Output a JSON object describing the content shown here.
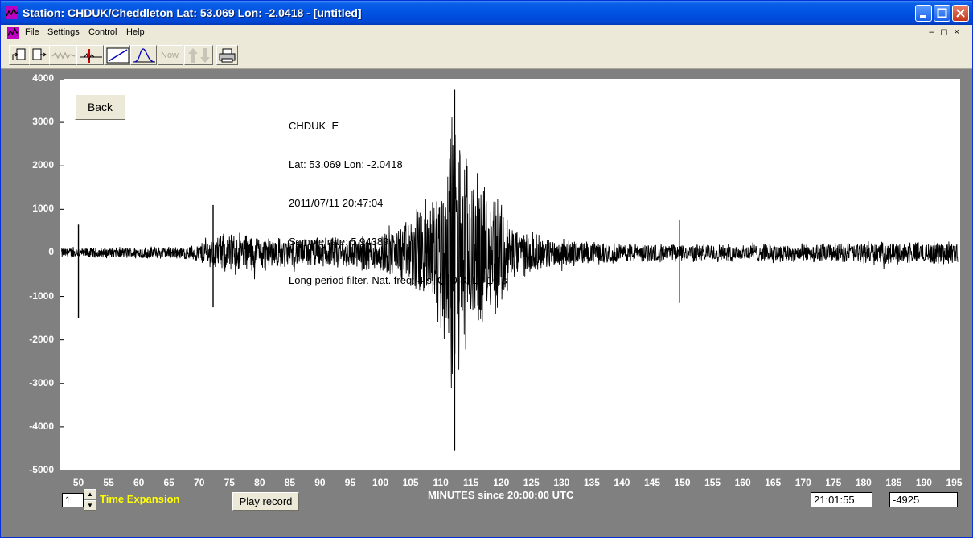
{
  "window": {
    "title": "Station: CHDUK/Cheddleton Lat: 53.069 Lon: -2.0418 - [untitled]"
  },
  "menu": {
    "items": [
      "File",
      "Settings",
      "Control",
      "Help"
    ],
    "mdi_controls": "–◻×"
  },
  "toolbar": {
    "now_label": "Now",
    "tools": [
      "open-file-icon",
      "save-file-icon",
      "wave-icon",
      "marker-icon",
      "ramp-icon",
      "curve-icon",
      "now-icon",
      "up-down-arrows-icon",
      "print-icon"
    ]
  },
  "plot": {
    "back_label": "Back",
    "info_lines": [
      "CHDUK  E",
      "Lat: 53.069 Lon: -2.0418",
      "2011/07/11 20:47:04",
      "Sample rate: 5.94389",
      "Long period filter. Nat. freq: 4 s, Q: 0.8, LP 10 s"
    ]
  },
  "chart_data": {
    "type": "line",
    "title": "",
    "xlabel": "MINUTES since 20:00:00 UTC",
    "ylabel": "",
    "xlim": [
      47,
      196
    ],
    "ylim": [
      -5000,
      4000
    ],
    "y_ticks": [
      "4000",
      "3000",
      "2000",
      "1000",
      "0",
      "-1000",
      "-2000",
      "-3000",
      "-4000",
      "-5000"
    ],
    "x_ticks": [
      "50",
      "55",
      "60",
      "65",
      "70",
      "75",
      "80",
      "85",
      "90",
      "95",
      "100",
      "105",
      "110",
      "115",
      "120",
      "125",
      "130",
      "135",
      "140",
      "145",
      "150",
      "155",
      "160",
      "165",
      "170",
      "175",
      "180",
      "185",
      "190",
      "195"
    ],
    "series": [
      {
        "amplitude_envelope": {
          "x": [
            47,
            50,
            60,
            68,
            70,
            73,
            76,
            80,
            85,
            95,
            100,
            103,
            105,
            107,
            109,
            110,
            111,
            112,
            113,
            114,
            115,
            116,
            117,
            118,
            119,
            120,
            121,
            122,
            124,
            126,
            128,
            130,
            135,
            140,
            145,
            150,
            160,
            170,
            180,
            190,
            196
          ],
          "y": [
            130,
            130,
            150,
            160,
            250,
            450,
            550,
            450,
            350,
            400,
            500,
            650,
            900,
            1300,
            1700,
            2000,
            2800,
            3800,
            3200,
            2700,
            2200,
            1900,
            1700,
            1500,
            1700,
            1500,
            1000,
            700,
            550,
            450,
            380,
            350,
            280,
            250,
            230,
            220,
            220,
            230,
            260,
            280,
            300
          ]
        },
        "spikes": [
          {
            "x": 50.0,
            "min": -1500,
            "max": 650
          },
          {
            "x": 72.3,
            "min": -1250,
            "max": 1100
          },
          {
            "x": 149.5,
            "min": -1150,
            "max": 750
          },
          {
            "x": 112.3,
            "min": -4550,
            "max": 3750
          }
        ]
      }
    ]
  },
  "footer": {
    "time_expansion_value": "1",
    "time_expansion_label": "Time Expansion",
    "play_record_label": "Play record",
    "time_readout": "21:01:55",
    "value_readout": "-4925"
  }
}
